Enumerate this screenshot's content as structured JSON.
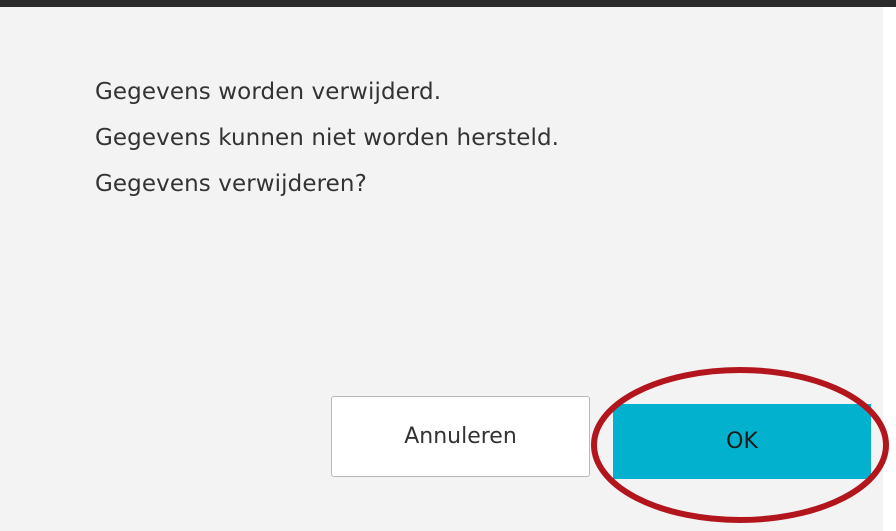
{
  "dialog": {
    "message_lines": [
      "Gegevens worden verwijderd.",
      "Gegevens kunnen niet worden hersteld.",
      "Gegevens verwijderen?"
    ]
  },
  "buttons": {
    "cancel_label": "Annuleren",
    "ok_label": "OK"
  },
  "colors": {
    "ok_button": "#02b1cd",
    "dialog_background": "#f3f3f3",
    "highlight_ring": "#b3151c"
  }
}
